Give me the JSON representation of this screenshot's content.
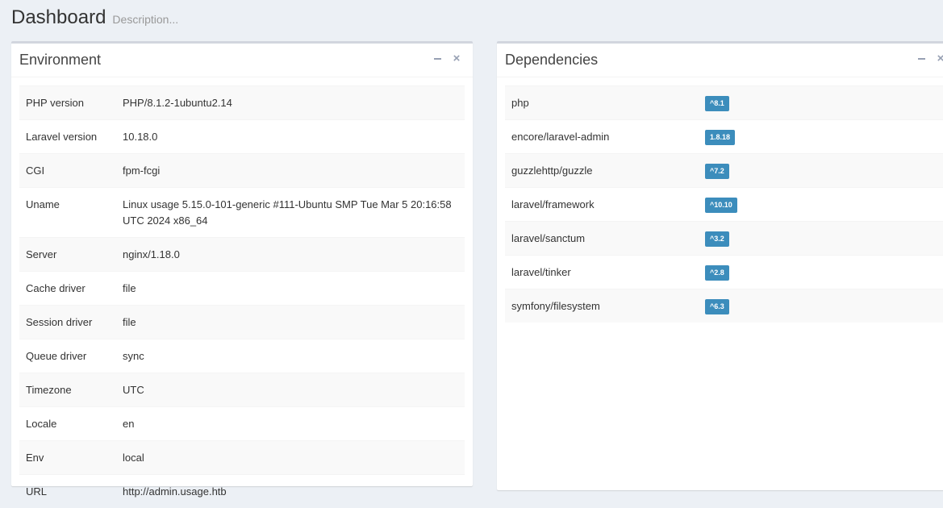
{
  "header": {
    "title": "Dashboard",
    "description": "Description..."
  },
  "environment": {
    "title": "Environment",
    "rows": [
      {
        "key": "PHP version",
        "value": "PHP/8.1.2-1ubuntu2.14"
      },
      {
        "key": "Laravel version",
        "value": "10.18.0"
      },
      {
        "key": "CGI",
        "value": "fpm-fcgi"
      },
      {
        "key": "Uname",
        "value": "Linux usage 5.15.0-101-generic #111-Ubuntu SMP Tue Mar 5 20:16:58 UTC 2024 x86_64"
      },
      {
        "key": "Server",
        "value": "nginx/1.18.0"
      },
      {
        "key": "Cache driver",
        "value": "file"
      },
      {
        "key": "Session driver",
        "value": "file"
      },
      {
        "key": "Queue driver",
        "value": "sync"
      },
      {
        "key": "Timezone",
        "value": "UTC"
      },
      {
        "key": "Locale",
        "value": "en"
      },
      {
        "key": "Env",
        "value": "local"
      },
      {
        "key": "URL",
        "value": "http://admin.usage.htb"
      }
    ]
  },
  "dependencies": {
    "title": "Dependencies",
    "rows": [
      {
        "name": "php",
        "version": "^8.1"
      },
      {
        "name": "encore/laravel-admin",
        "version": "1.8.18"
      },
      {
        "name": "guzzlehttp/guzzle",
        "version": "^7.2"
      },
      {
        "name": "laravel/framework",
        "version": "^10.10"
      },
      {
        "name": "laravel/sanctum",
        "version": "^3.2"
      },
      {
        "name": "laravel/tinker",
        "version": "^2.8"
      },
      {
        "name": "symfony/filesystem",
        "version": "^6.3"
      }
    ]
  },
  "colors": {
    "background": "#ecf0f5",
    "badge": "#3c8dbc"
  },
  "icons": {
    "collapse": "minus-icon",
    "remove": "close-icon"
  }
}
